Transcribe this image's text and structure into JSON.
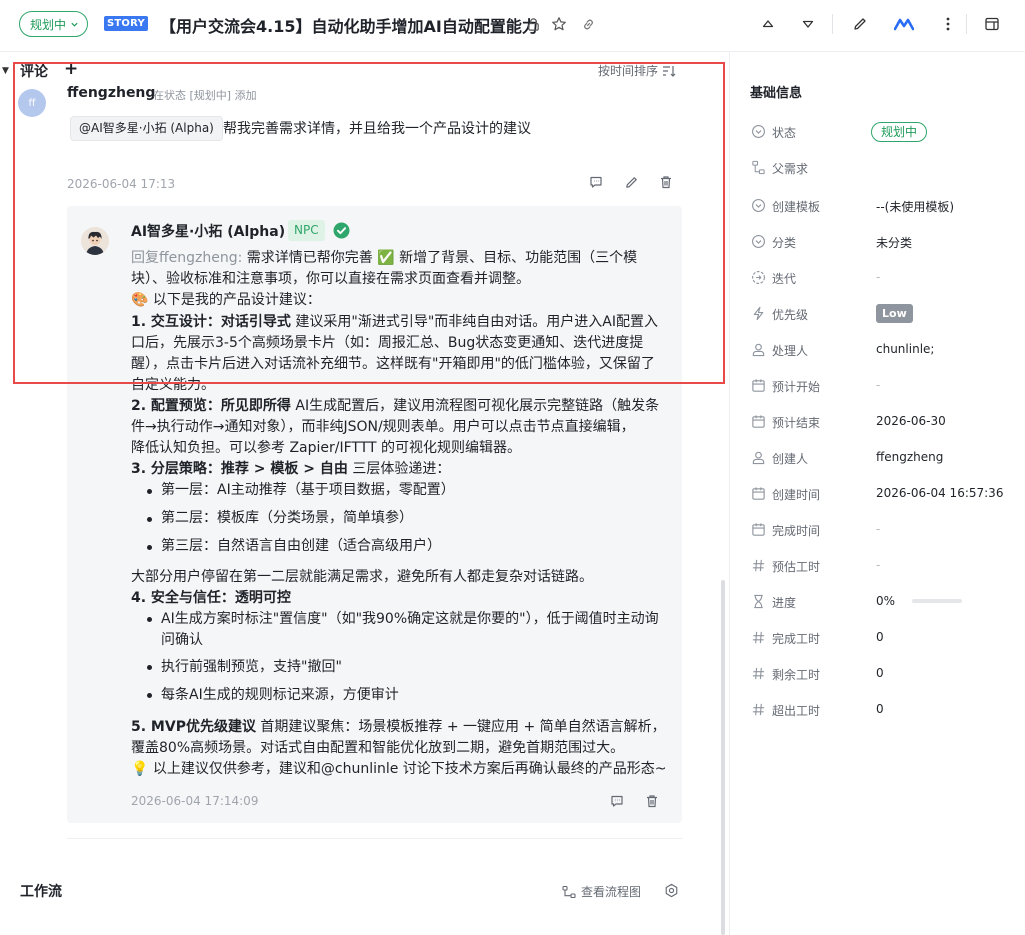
{
  "header": {
    "status": "规划中",
    "type_badge": "STORY",
    "title": "【用户交流会4.15】自动化助手增加AI自动配置能力"
  },
  "comments": {
    "section_title": "评论",
    "sort_label": "按时间排序",
    "comment": {
      "avatar_initials": "ff",
      "author": "ffengzheng",
      "meta": "在状态 [规划中] 添加",
      "mention": "@AI智多星·小拓 (Alpha)",
      "text": "帮我完善需求详情，并且给我一个产品设计的建议",
      "time": "2026-06-04 17:13"
    },
    "reply": {
      "author": "AI智多星·小拓 (Alpha)",
      "badge": "NPC",
      "reply_prefix": "回复ffengzheng:",
      "line1": " 需求详情已帮你完善 ✅ 新增了背景、目标、功能范围（三个模",
      "line2": "块）、验收标准和注意事项，你可以直接在需求页面查看并调整。",
      "line3": "🎨 以下是我的产品设计建议：",
      "p1_title": "1. 交互设计：对话引导式",
      "p1_a": " 建议采用\"渐进式引导\"而非纯自由对话。用户进入AI配置入",
      "p1_b": "口后，先展示3-5个高频场景卡片（如：周报汇总、Bug状态变更通知、迭代进度提",
      "p1_c": "醒），点击卡片后进入对话流补充细节。这样既有\"开箱即用\"的低门槛体验，又保留了",
      "p1_d": "自定义能力。",
      "p2_title": "2. 配置预览：所见即所得",
      "p2_a": " AI生成配置后，建议用流程图可视化展示完整链路（触发条",
      "p2_b": "件→执行动作→通知对象），而非纯JSON/规则表单。用户可以点击节点直接编辑，",
      "p2_c": "降低认知负担。可以参考 Zapier/IFTTT 的可视化规则编辑器。",
      "p3_title": "3. 分层策略：推荐 > 模板 > 自由",
      "p3_a": " 三层体验递进：",
      "p3_items": [
        "第一层：AI主动推荐（基于项目数据，零配置）",
        "第二层：模板库（分类场景，简单填参）",
        "第三层：自然语言自由创建（适合高级用户）"
      ],
      "p3_after": "大部分用户停留在第一二层就能满足需求，避免所有人都走复杂对话链路。",
      "p4_title": "4. 安全与信任：透明可控",
      "p4_item1a": "AI生成方案时标注\"置信度\"（如\"我90%确定这就是你要的\"），低于阈值时主动询",
      "p4_item1b": "问确认",
      "p4_item2": "执行前强制预览，支持\"撤回\"",
      "p4_item3": "每条AI生成的规则标记来源，方便审计",
      "p5_title": "5. MVP优先级建议",
      "p5_a": " 首期建议聚焦：场景模板推荐 + 一键应用 + 简单自然语言解析，",
      "p5_b": "覆盖80%高频场景。对话式自由配置和智能优化放到二期，避免首期范围过大。",
      "closing": "💡 以上建议仅供参考，建议和@chunlinle 讨论下技术方案后再确认最终的产品形态~",
      "time": "2026-06-04 17:14:09"
    }
  },
  "workflow": {
    "title": "工作流",
    "view_flow": "查看流程图"
  },
  "basic_info": {
    "title": "基础信息",
    "fields": {
      "status": {
        "label": "状态",
        "value": "规划中"
      },
      "parent": {
        "label": "父需求",
        "value": ""
      },
      "template": {
        "label": "创建模板",
        "value": "--(未使用模板)"
      },
      "category": {
        "label": "分类",
        "value": "未分类"
      },
      "iteration": {
        "label": "迭代",
        "value": "-"
      },
      "priority": {
        "label": "优先级",
        "value": "Low"
      },
      "assignee": {
        "label": "处理人",
        "value": "chunlinle;"
      },
      "plan_start": {
        "label": "预计开始",
        "value": "-"
      },
      "plan_end": {
        "label": "预计结束",
        "value": "2026-06-30"
      },
      "creator": {
        "label": "创建人",
        "value": "ffengzheng"
      },
      "created_at": {
        "label": "创建时间",
        "value": "2026-06-04 16:57:36"
      },
      "done_at": {
        "label": "完成时间",
        "value": "-"
      },
      "estimate": {
        "label": "预估工时",
        "value": "-"
      },
      "progress": {
        "label": "进度",
        "value": "0%",
        "fraction": 0
      },
      "done_hours": {
        "label": "完成工时",
        "value": "0"
      },
      "remaining": {
        "label": "剩余工时",
        "value": "0"
      },
      "overtime": {
        "label": "超出工时",
        "value": "0"
      }
    }
  }
}
